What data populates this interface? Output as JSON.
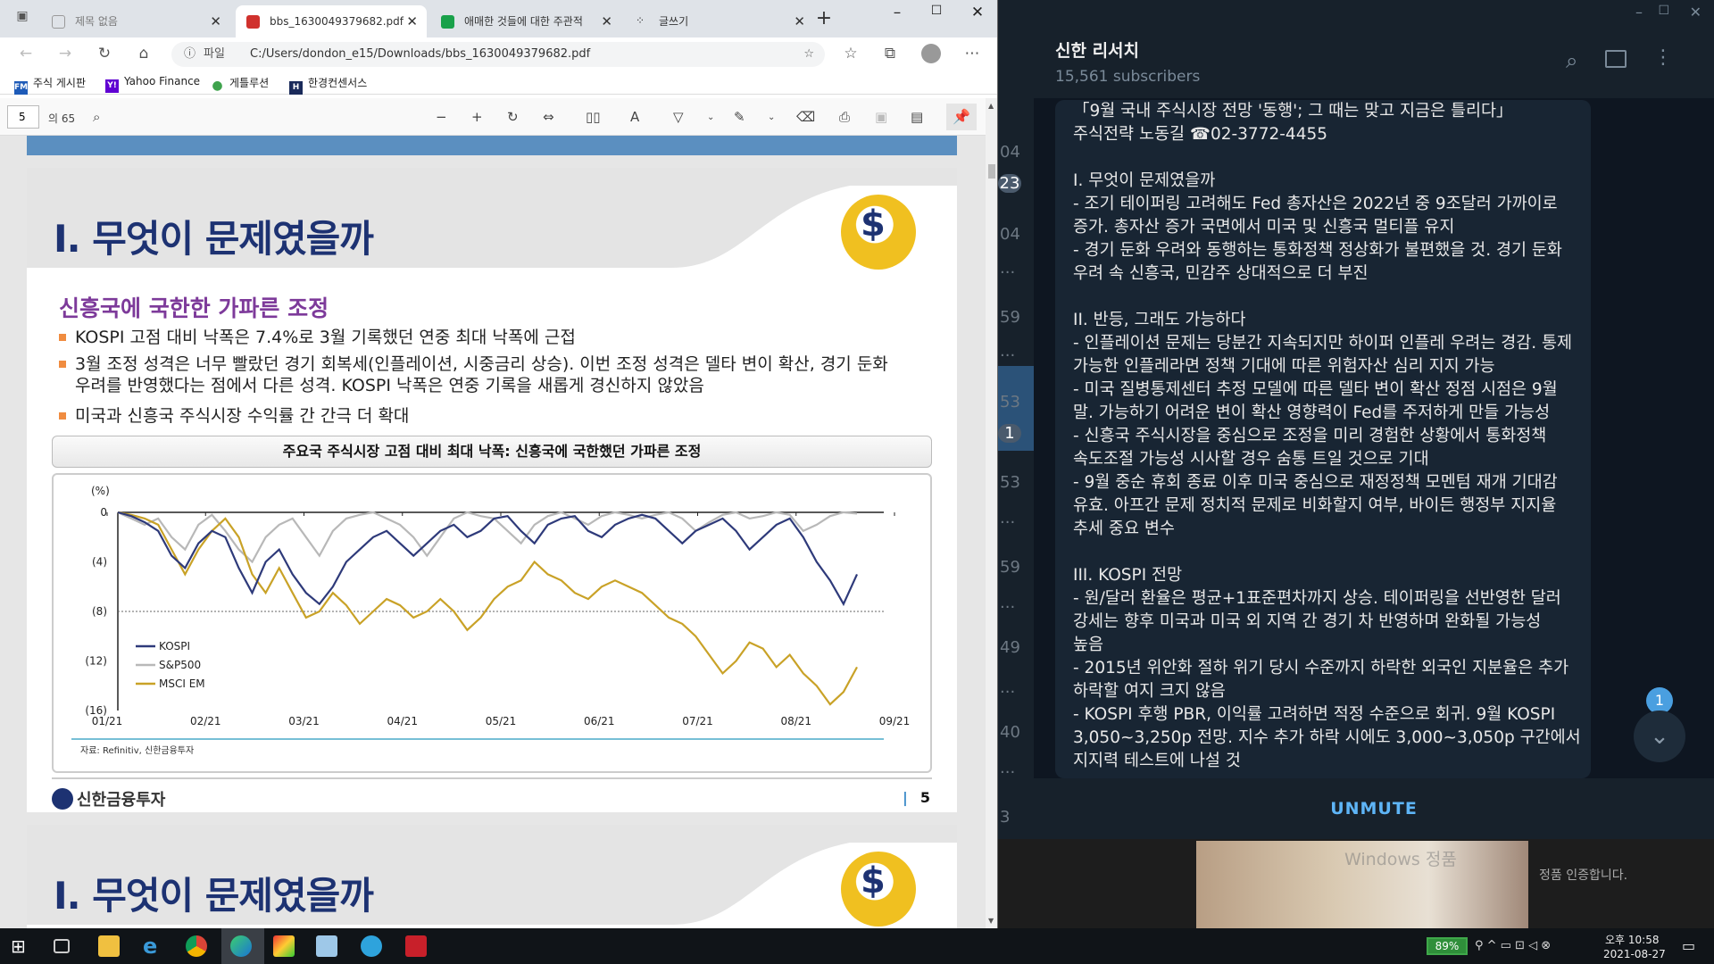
{
  "browser": {
    "tabs": [
      {
        "title": "제목 없음",
        "icon_color": "#ffffff"
      },
      {
        "title": "bbs_1630049379682.pdf",
        "icon_color": "#d0312d"
      },
      {
        "title": "애매한 것들에 대한 주관적",
        "icon_color": "#19a14a"
      },
      {
        "title": "글쓰기",
        "icon_color": "#333333"
      }
    ],
    "address_prefix": "파일",
    "address": "C:/Users/dondon_e15/Downloads/bbs_1630049379682.pdf",
    "bookmarks": [
      {
        "label": "주식 게시판",
        "icon": "FM",
        "color": "#1e5bb8"
      },
      {
        "label": "Yahoo Finance",
        "icon": "Y!",
        "color": "#6001d2"
      },
      {
        "label": "게틀루션",
        "icon": "●",
        "color": "#3fa34d"
      },
      {
        "label": "한경컨센서스",
        "icon": "H",
        "color": "#1a2a5a"
      }
    ]
  },
  "pdf_toolbar": {
    "page_current": "5",
    "page_total": "의 65"
  },
  "pdf_page": {
    "title": "I. 무엇이 문제였을까",
    "subtitle": "신흥국에 국한한 가파른 조정",
    "bullets": [
      "KOSPI 고점 대비 낙폭은 7.4%로 3월 기록했던 연중 최대 낙폭에 근접",
      "3월 조정 성격은 너무 빨랐던 경기 회복세(인플레이션, 시중금리 상승). 이번 조정 성격은 델타 변이 확산, 경기 둔화",
      "우려를 반영했다는 점에서 다른 성격.  KOSPI 낙폭은 연중 기록을 새롭게 경신하지 않았음",
      "미국과 신흥국 주식시장 수익률 간 간극 더 확대"
    ],
    "chart_caption": "주요국 주식시장 고점 대비 최대 낙폭: 신흥국에 국한했던 가파른 조정",
    "source": "자료: Refinitiv, 신한금융투자",
    "brand": "신한금융투자",
    "page_number": "5",
    "next_title": "I. 무엇이 문제였을까"
  },
  "chart_data": {
    "type": "line",
    "ylabel": "(%)",
    "ylim": [
      -16,
      0
    ],
    "y_ticks": [
      "0",
      "(4)",
      "(8)",
      "(12)",
      "(16)"
    ],
    "x_ticks": [
      "01/21",
      "02/21",
      "03/21",
      "04/21",
      "05/21",
      "06/21",
      "07/21",
      "08/21",
      "09/21"
    ],
    "reference_line": -8,
    "series": [
      {
        "name": "KOSPI",
        "color": "#2e3a7a",
        "values": [
          0,
          -0.3,
          -0.8,
          -1.5,
          -3.5,
          -4.5,
          -2.5,
          -1.5,
          -2,
          -4.5,
          -6.5,
          -4,
          -3,
          -5,
          -6.5,
          -7.4,
          -6,
          -4,
          -3,
          -2,
          -1.5,
          -2.5,
          -3.5,
          -2.5,
          -1.5,
          -1,
          -2,
          -1.5,
          -0.5,
          -0.3,
          -1.5,
          -2.5,
          -1,
          -0.5,
          -0.3,
          -1.5,
          -2,
          -1,
          -0.5,
          -0.2,
          -0.5,
          -1.5,
          -2.5,
          -1.5,
          -1,
          -0.5,
          -1.5,
          -3,
          -2,
          -1,
          -0.5,
          -2,
          -4,
          -5.5,
          -7.4,
          -5
        ]
      },
      {
        "name": "S&P500",
        "color": "#b8b8b8",
        "values": [
          0,
          -0.5,
          -1,
          -0.5,
          -2,
          -3,
          -1,
          -0.2,
          -1.5,
          -3,
          -4,
          -2,
          -1,
          -0.5,
          -2,
          -3.5,
          -1.5,
          -0.5,
          -0.2,
          0,
          -0.5,
          -1,
          -2,
          -3.5,
          -2,
          -0.5,
          0,
          -0.3,
          -0.5,
          -1.5,
          -2.5,
          -1,
          -0.3,
          0,
          -0.5,
          -1,
          -0.3,
          0,
          -0.2,
          -0.5,
          -0.2,
          0,
          -0.5,
          -1.5,
          -0.8,
          -0.2,
          0,
          -0.5,
          -0.3,
          0,
          -0.2,
          -1.5,
          -1,
          -0.3,
          0,
          -0.1
        ]
      },
      {
        "name": "MSCI EM",
        "color": "#c9a227",
        "values": [
          0,
          -0.2,
          -0.5,
          -1,
          -3,
          -5,
          -3,
          -1.5,
          -0.5,
          -2,
          -5,
          -6.5,
          -4.5,
          -6.5,
          -8.5,
          -8,
          -6.5,
          -7.5,
          -9,
          -8,
          -7,
          -7.5,
          -8.5,
          -8,
          -7,
          -8,
          -9.5,
          -8.5,
          -7,
          -6,
          -5.5,
          -4,
          -5,
          -5.5,
          -6.5,
          -7,
          -6,
          -5.5,
          -6,
          -6.5,
          -7.5,
          -8.5,
          -9,
          -10,
          -11.5,
          -13,
          -12,
          -10.5,
          -11,
          -12.5,
          -11.5,
          -13,
          -14,
          -15.5,
          -14.5,
          -12.5
        ]
      }
    ]
  },
  "telegram": {
    "channel": "신한 리서치",
    "subscribers": "15,561 subscribers",
    "left_numbers": [
      "04",
      "23",
      "04",
      "...",
      "59",
      "...",
      "53",
      "1",
      "53",
      "...",
      "59",
      "...",
      "49",
      "...",
      "40",
      "...",
      "3"
    ],
    "message_lines": [
      "「9월 국내 주식시장 전망 '동행'; 그 때는 맞고 지금은 틀리다」",
      "주식전략 노동길 ☎02-3772-4455",
      "",
      "I. 무엇이 문제였을까",
      "- 조기 테이퍼링 고려해도 Fed 총자산은 2022년 중 9조달러 가까이로",
      "증가. 총자산 증가 국면에서 미국 및 신흥국 멀티플 유지",
      "- 경기 둔화 우려와 동행하는 통화정책 정상화가 불편했을 것. 경기 둔화",
      "우려 속 신흥국, 민감주 상대적으로 더 부진",
      "",
      "II. 반등, 그래도 가능하다",
      "- 인플레이션 문제는 당분간 지속되지만 하이퍼 인플레 우려는 경감. 통제",
      "가능한 인플레라면 정책 기대에 따른 위험자산 심리 지지 가능",
      "- 미국 질병통제센터 추정 모델에 따른 델타 변이 확산 정점 시점은 9월",
      "말. 가능하기 어려운 변이 확산 영향력이 Fed를 주저하게 만들 가능성",
      "- 신흥국 주식시장을 중심으로 조정을 미리 경험한 상황에서 통화정책",
      "속도조절 가능성 시사할 경우 숨통 트일 것으로 기대",
      "- 9월 중순 휴회 종료 이후 미국 중심으로 재정정책 모멘텀 재개 기대감",
      "유효. 아프간 문제 정치적 문제로 비화할지 여부, 바이든 행정부 지지율",
      "추세 중요 변수",
      "",
      "III. KOSPI 전망",
      "- 원/달러 환율은 평균+1표준편차까지 상승. 테이퍼링을 선반영한 달러",
      "강세는 향후 미국과 미국 외 지역 간 경기 차 반영하며 완화될 가능성",
      "높음",
      "- 2015년 위안화 절하 위기 당시 수준까지 하락한 외국인 지분율은 추가",
      "하락할 여지 크지 않음",
      "- KOSPI 후행 PBR, 이익률 고려하면 적정 수준으로 회귀. 9월 KOSPI",
      "3,050~3,250p 전망. 지수 추가 하락 시에도 3,000~3,050p 구간에서",
      "지지력 테스트에 나설 것"
    ],
    "unread_badge": "1",
    "unmute": "UNMUTE"
  },
  "overlay_text": {
    "win_activate": "Windows 정품",
    "win_activate2": "정품 인증합니다."
  },
  "taskbar": {
    "battery": "89%",
    "time": "오후 10:58",
    "date": "2021-08-27"
  }
}
